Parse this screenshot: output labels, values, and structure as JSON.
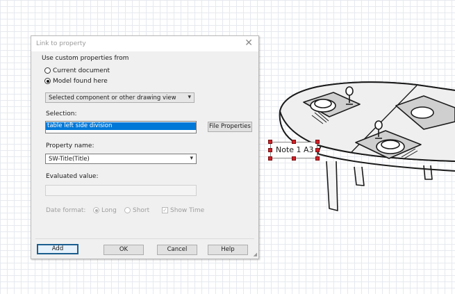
{
  "dialog": {
    "title": "Link to property",
    "close_glyph": "✕",
    "group_label": "Use custom properties from",
    "radio_current": "Current document",
    "radio_model": "Model found here",
    "component_combo": "Selected component or other drawing view",
    "selection_label": "Selection:",
    "selection_value": "table left side division",
    "file_properties_button": "File Properties",
    "property_name_label": "Property name:",
    "property_name_value": "SW-Title(Title)",
    "evaluated_label": "Evaluated value:",
    "evaluated_value": "",
    "date_format_label": "Date format:",
    "date_long": "Long",
    "date_short": "Short",
    "show_time": "Show Time",
    "buttons": {
      "add": "Add",
      "ok": "OK",
      "cancel": "Cancel",
      "help": "Help"
    }
  },
  "drawing": {
    "note_text": "Note 1 A3"
  },
  "icons": {
    "dropdown": "▾",
    "check": "✓"
  }
}
